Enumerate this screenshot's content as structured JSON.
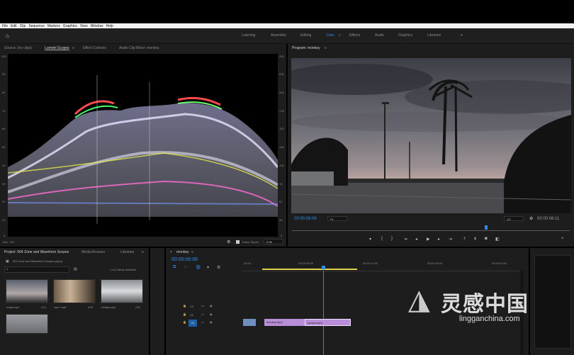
{
  "menu": [
    "File",
    "Edit",
    "Clip",
    "Sequence",
    "Markers",
    "Graphics",
    "View",
    "Window",
    "Help"
  ],
  "workspaces": [
    "Learning",
    "Assembly",
    "Editing",
    "Color",
    "Effects",
    "Audio",
    "Graphics",
    "Libraries"
  ],
  "active_workspace": "Color",
  "source_panel": {
    "tabs": [
      "Source: (no clips)",
      "Lumetri Scopes",
      "Effect Controls",
      "Audio Clip Mixer: monkey"
    ],
    "active_tab": "Lumetri Scopes",
    "scale_left": [
      "100",
      "90",
      "80",
      "70",
      "60",
      "50",
      "40",
      "30",
      "20",
      "10",
      "0"
    ],
    "scale_right": [
      "255",
      "230",
      "204",
      "178",
      "153",
      "128",
      "102",
      "76",
      "51",
      "26",
      "0"
    ],
    "footer_left": "Rec. 709",
    "clamp_label": "Clamp Signal",
    "bit_depth": "8 Bit"
  },
  "program": {
    "title": "Program: monkey",
    "timecode_in": "00:00:06:06",
    "fit": "Fit",
    "resolution": "1/2",
    "timecode_out": "00:00:08:11",
    "playhead_fraction": 0.7
  },
  "project": {
    "tabs": [
      "Project: 004 Zone and Waveform Scopes",
      "Media Browser",
      "Libraries"
    ],
    "path": "004 Zone and Waveform Scopes.prproj",
    "selected_count": "1 of 4 items selected",
    "items": [
      {
        "name": "sunset.mp4",
        "dur": "2:14"
      },
      {
        "name": "man 1.mp4",
        "dur": "3:00"
      },
      {
        "name": "monkey.mp4",
        "dur": "2:02"
      }
    ]
  },
  "timeline": {
    "sequence": "monkey",
    "timecode": "00:00:06:06",
    "ruler": [
      "00:00",
      "00:00:05:00",
      "00:00:10:00",
      "00:00:15:00",
      "00:00:20:00"
    ],
    "tracks": [
      "V3",
      "V2",
      "V1"
    ],
    "clips": [
      "monkey.mp4",
      "sunset.mp4"
    ]
  },
  "watermark": {
    "cn": "灵感中国",
    "url": "lingganchina.com"
  },
  "colors": {
    "accent": "#2d8ceb",
    "clip": "#b88ed8",
    "clip_first": "#6e8fbf",
    "playhead": "#2d8ceb"
  }
}
